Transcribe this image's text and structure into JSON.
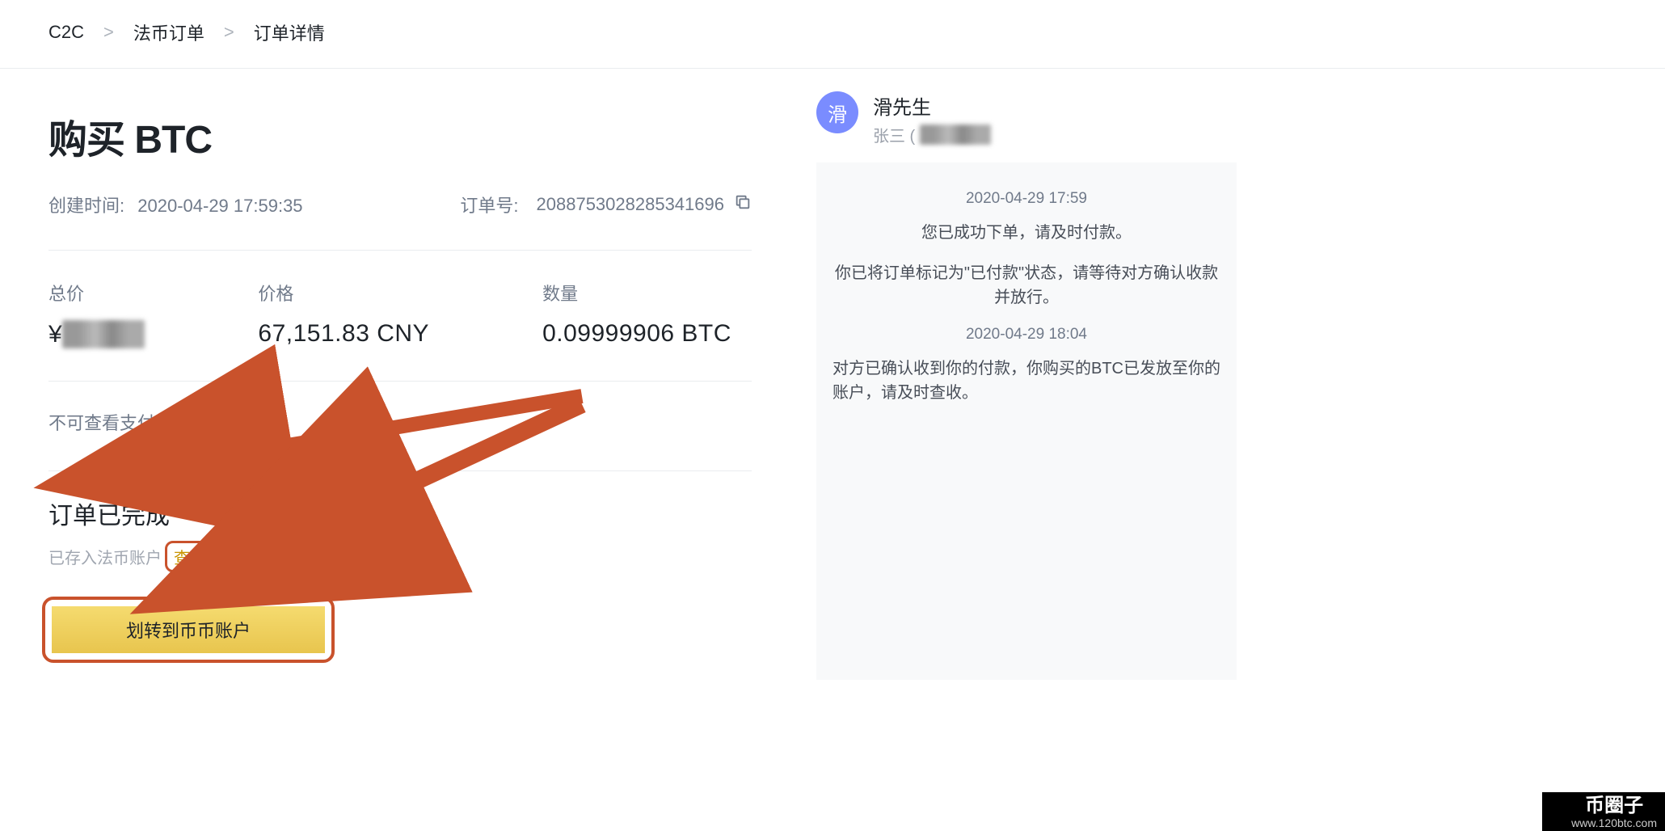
{
  "breadcrumb": {
    "root": "C2C",
    "mid": "法币订单",
    "leaf": "订单详情"
  },
  "title": "购买 BTC",
  "meta": {
    "created_label": "创建时间:",
    "created_value": "2020-04-29 17:59:35",
    "order_label": "订单号:",
    "order_value": "208875302828534169​6"
  },
  "stats": {
    "total_label": "总价",
    "total_prefix": "¥",
    "total_value_masked": "▮▮▮▮▮2",
    "price_label": "价格",
    "price_value": "67,151.83 CNY",
    "qty_label": "数量",
    "qty_value": "0.09999906 BTC"
  },
  "payment_note": "不可查看支付方式",
  "complete": {
    "heading": "订单已完成",
    "deposited": "已存入法币账户",
    "view_assets": "查看资产",
    "transfer_button": "划转到币币账户"
  },
  "seller": {
    "avatar_char": "滑",
    "name": "滑先生",
    "sub_prefix": "张三 ("
  },
  "chat": {
    "ts1": "2020-04-29 17:59",
    "msg1": "您已成功下单，请及时付款。",
    "msg2": "你已将订单标记为\"已付款\"状态，请等待对方确认收款并放行。",
    "ts2": "2020-04-29 18:04",
    "msg3": "对方已确认收到你的付款，你购买的BTC已发放至你的账户，请及时查收。"
  },
  "watermark": {
    "brand": "币圈子",
    "url": "www.120btc.com"
  },
  "colors": {
    "accent": "#c9522c",
    "button_gold": "#eccd59"
  }
}
